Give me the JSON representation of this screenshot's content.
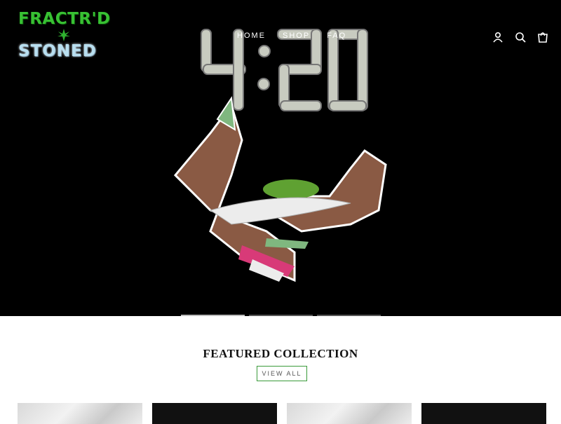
{
  "logo": {
    "line1": "FRACTR'D",
    "line2": "STONED"
  },
  "nav": {
    "items": [
      {
        "label": "HOME"
      },
      {
        "label": "SHOP"
      },
      {
        "label": "FAQ"
      }
    ]
  },
  "header_icons": [
    "account-icon",
    "search-icon",
    "cart-icon"
  ],
  "hero": {
    "clock_text": "4:20",
    "slides_count": 3,
    "active_slide": 1
  },
  "featured": {
    "title": "FEATURED COLLECTION",
    "view_all_label": "VIEW ALL"
  },
  "products": [
    {
      "style": "marble"
    },
    {
      "style": "dark"
    },
    {
      "style": "marble"
    },
    {
      "style": "dark"
    }
  ],
  "colors": {
    "hero_bg": "#000000",
    "logo_green": "#38c133",
    "view_all_border": "#3a9a3a"
  }
}
